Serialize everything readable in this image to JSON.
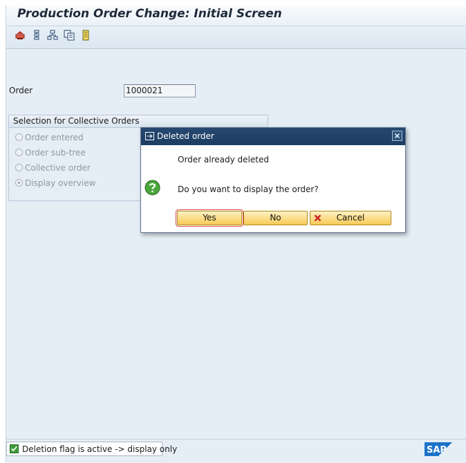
{
  "window": {
    "title": "Production Order Change: Initial Screen"
  },
  "toolbar": {
    "icons": [
      "order-type-icon",
      "structure-icon",
      "hierarchy-icon",
      "copy-icon",
      "list-icon"
    ]
  },
  "form": {
    "order_label": "Order",
    "order_value": "1000021"
  },
  "group": {
    "title": "Selection for Collective Orders",
    "options": [
      {
        "label": "Order entered",
        "selected": false
      },
      {
        "label": "Order sub-tree",
        "selected": false
      },
      {
        "label": "Collective order",
        "selected": false
      },
      {
        "label": "Display overview",
        "selected": true
      }
    ]
  },
  "dialog": {
    "title": "Deleted order",
    "message": "Order already deleted",
    "question": "Do you want to display the order?",
    "yes_label": "Yes",
    "no_label": "No",
    "cancel_label": "Cancel"
  },
  "status": {
    "message": "Deletion flag is active -> display only",
    "logo": "SAP"
  },
  "colors": {
    "background": "#e5edf5",
    "dialog_title": "#1d3d62",
    "button": "#f7c955",
    "success": "#3f9b3b"
  }
}
